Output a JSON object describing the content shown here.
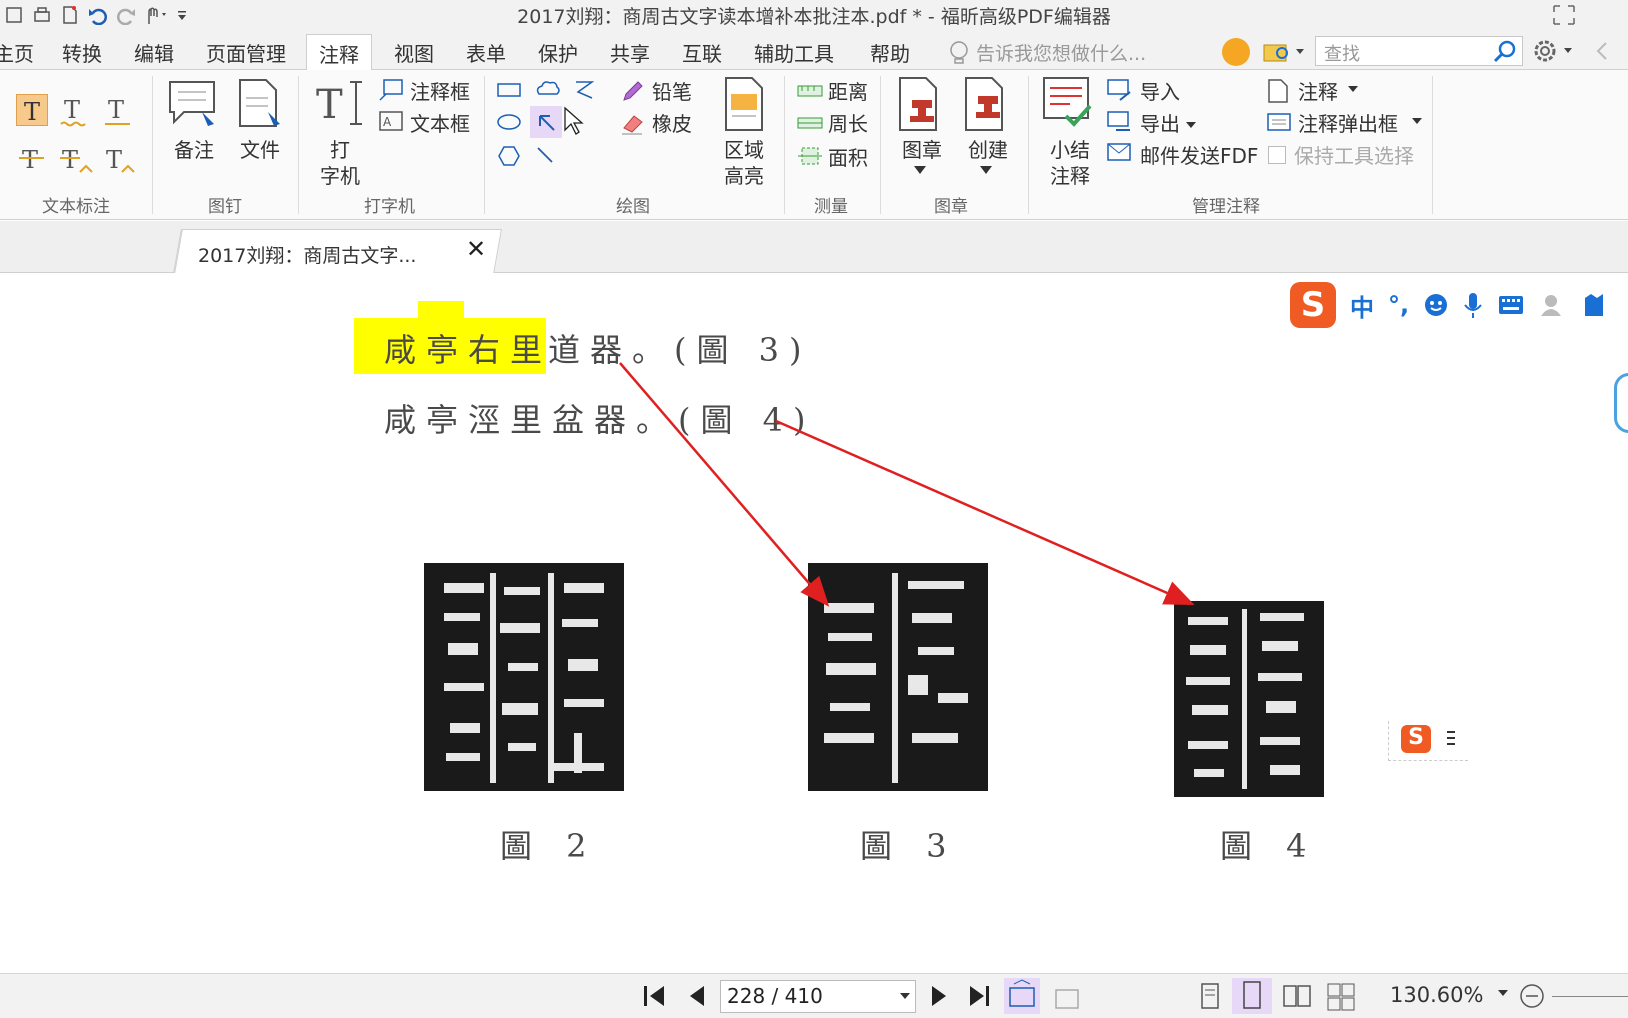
{
  "app": {
    "title": "2017刘翔：商周古文字读本增补本批注本.pdf * - 福昕高级PDF编辑器"
  },
  "menu": {
    "items": [
      "主页",
      "转换",
      "编辑",
      "页面管理",
      "注释",
      "视图",
      "表单",
      "保护",
      "共享",
      "互联",
      "辅助工具",
      "帮助"
    ],
    "active": "注释",
    "tell_me": "告诉我您想做什么...",
    "search_placeholder": "查找"
  },
  "ribbon": {
    "groups": {
      "text_markup": "文本标注",
      "pin": "图钉",
      "typewriter": "打字机",
      "drawing": "绘图",
      "measure": "测量",
      "stamp": "图章",
      "manage": "管理注释"
    },
    "pin_note": "备注",
    "pin_file": "文件",
    "typewriter_line1": "打",
    "typewriter_line2": "字机",
    "callout": "注释框",
    "textbox": "文本框",
    "pencil": "铅笔",
    "eraser": "橡皮",
    "area_line1": "区域",
    "area_line2": "高亮",
    "distance": "距离",
    "perimeter": "周长",
    "area": "面积",
    "stamp": "图章",
    "create": "创建",
    "summary_line1": "小结",
    "summary_line2": "注释",
    "import": "导入",
    "export": "导出",
    "email_fdf": "邮件发送FDF",
    "comments": "注释",
    "popup_notes": "注释弹出框",
    "keep_tool": "保持工具选择"
  },
  "tab": {
    "label": "2017刘翔：商周古文字...",
    "close": "✕"
  },
  "document": {
    "line1_highlight": "咸亭右里",
    "line1_rest": "道器。(圖 3)",
    "line2": "咸亭涇里盆器。(圖 4)",
    "captions": [
      "圖 2",
      "圖 3",
      "圖 4"
    ]
  },
  "ime": {
    "logo": "S",
    "lang": "中",
    "punct": "°,"
  },
  "status": {
    "page": "228 / 410",
    "zoom": "130.60%"
  },
  "colors": {
    "highlight": "#ffff00",
    "arrow": "#e02020",
    "accent_blue": "#1a6fd4",
    "ime_orange": "#f05a23"
  }
}
